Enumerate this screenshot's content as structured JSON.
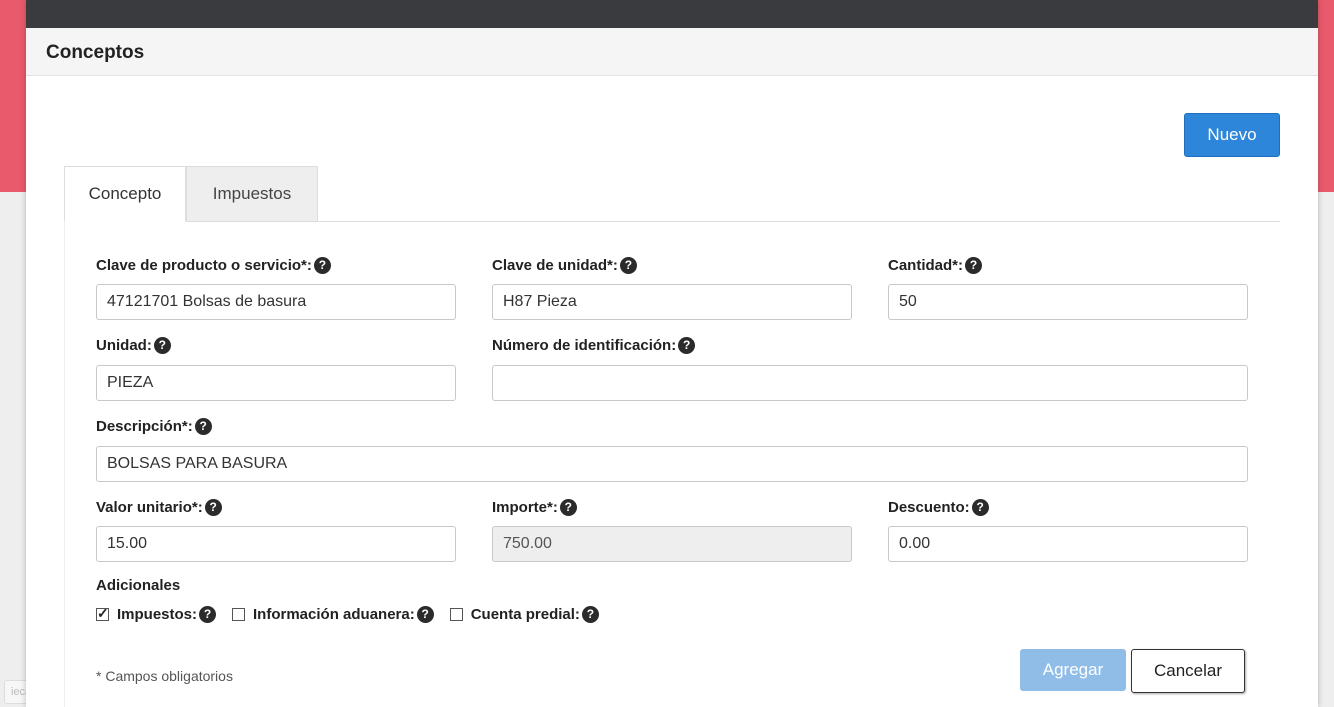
{
  "panel": {
    "title": "Conceptos",
    "new_button": "Nuevo"
  },
  "tabs": [
    {
      "label": "Concepto",
      "active": true
    },
    {
      "label": "Impuestos",
      "active": false
    }
  ],
  "form": {
    "clave_producto": {
      "label": "Clave de producto o servicio*:",
      "value": "47121701 Bolsas de basura"
    },
    "clave_unidad": {
      "label": "Clave de unidad*:",
      "value": "H87 Pieza"
    },
    "cantidad": {
      "label": "Cantidad*:",
      "value": "50"
    },
    "unidad": {
      "label": "Unidad:",
      "value": "PIEZA"
    },
    "numero_identificacion": {
      "label": "Número de identificación:",
      "value": ""
    },
    "descripcion": {
      "label": "Descripción*:",
      "value": "BOLSAS PARA BASURA"
    },
    "valor_unitario": {
      "label": "Valor unitario*:",
      "value": "15.00"
    },
    "importe": {
      "label": "Importe*:",
      "value": "750.00"
    },
    "descuento": {
      "label": "Descuento:",
      "value": "0.00"
    }
  },
  "adicionales": {
    "title": "Adicionales",
    "options": [
      {
        "label": "Impuestos:",
        "checked": true
      },
      {
        "label": "Información aduanera:",
        "checked": false
      },
      {
        "label": "Cuenta predial:",
        "checked": false
      }
    ]
  },
  "footer": {
    "note": "* Campos obligatorios",
    "add_button": "Agregar",
    "cancel_button": "Cancelar"
  },
  "help_glyph": "?",
  "watermark": "ieca.gob.mx",
  "colors": {
    "accent_pink": "#e95b6c",
    "topbar": "#3a3b3f",
    "primary_button": "#2d86d9",
    "disabled_button": "#8fbde8"
  }
}
